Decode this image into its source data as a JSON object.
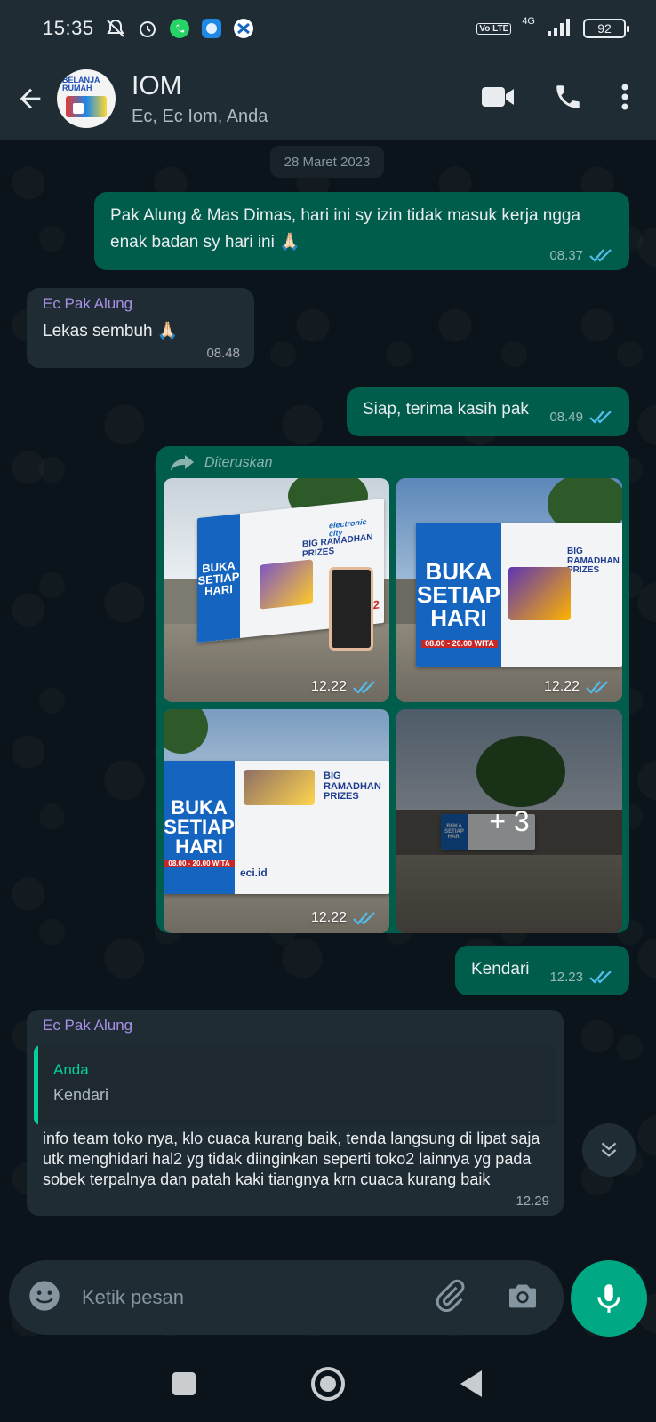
{
  "status_bar": {
    "time": "15:35",
    "network": "4G",
    "volte": "Vo LTE",
    "battery": "92"
  },
  "header": {
    "chat_name": "IOM",
    "members": "Ec, Ec Iom, Anda",
    "avatar_text": "BELANJA RUMAH"
  },
  "chat": {
    "date_chip": "28 Maret 2023",
    "messages": [
      {
        "text": "Pak Alung & Mas Dimas, hari ini sy izin tidak masuk kerja ngga enak badan sy hari ini 🙏🏻",
        "time": "08.37"
      },
      {
        "sender": "Ec Pak Alung",
        "text": "Lekas sembuh 🙏🏻",
        "time": "08.48"
      },
      {
        "text": "Siap, terima kasih pak",
        "time": "08.49"
      },
      {
        "forwarded_label": "Diteruskan",
        "photos": [
          {
            "time": "12.22",
            "banner_left": "BUKA SETIAP HARI",
            "banner_title": "BIG RAMADHAN PRIZES",
            "banner_brand": "electronic city",
            "phone": "15000-32"
          },
          {
            "time": "12.22",
            "banner_left": "BUKA SETIAP HARI",
            "banner_hours": "08.00 - 20.00 WITA",
            "banner_title": "BIG RAMADHAN PRIZES"
          },
          {
            "time": "12.22",
            "banner_left": "BUKA SETIAP HARI",
            "banner_hours": "08.00 - 20.00 WITA",
            "banner_title": "BIG RAMADHAN PRIZES",
            "banner_sub": "eci.id"
          },
          {
            "more_label": "+ 3",
            "banner_left": "BUKA SETIAP HARI"
          }
        ]
      },
      {
        "text": "Kendari",
        "time": "12.23"
      },
      {
        "sender": "Ec Pak Alung",
        "quote_author": "Anda",
        "quote_text": "Kendari",
        "text": "info team toko nya, klo cuaca kurang baik, tenda langsung di lipat saja utk menghidari hal2 yg tidak diinginkan seperti toko2 lainnya yg pada sobek terpalnya dan patah kaki tiangnya krn cuaca kurang baik",
        "time": "12.29"
      }
    ]
  },
  "composer": {
    "placeholder": "Ketik pesan"
  },
  "colors": {
    "outgoing_bubble": "#005c4b",
    "incoming_bubble": "#202c33",
    "accent": "#00a884",
    "read_ticks": "#53bdeb",
    "sender_name": "#a790e6"
  },
  "icons": [
    "back-arrow-icon",
    "video-call-icon",
    "phone-icon",
    "more-vert-icon",
    "forward-icon",
    "read-ticks-icon",
    "emoji-icon",
    "attach-icon",
    "camera-icon",
    "mic-icon",
    "chevron-down-icon"
  ]
}
